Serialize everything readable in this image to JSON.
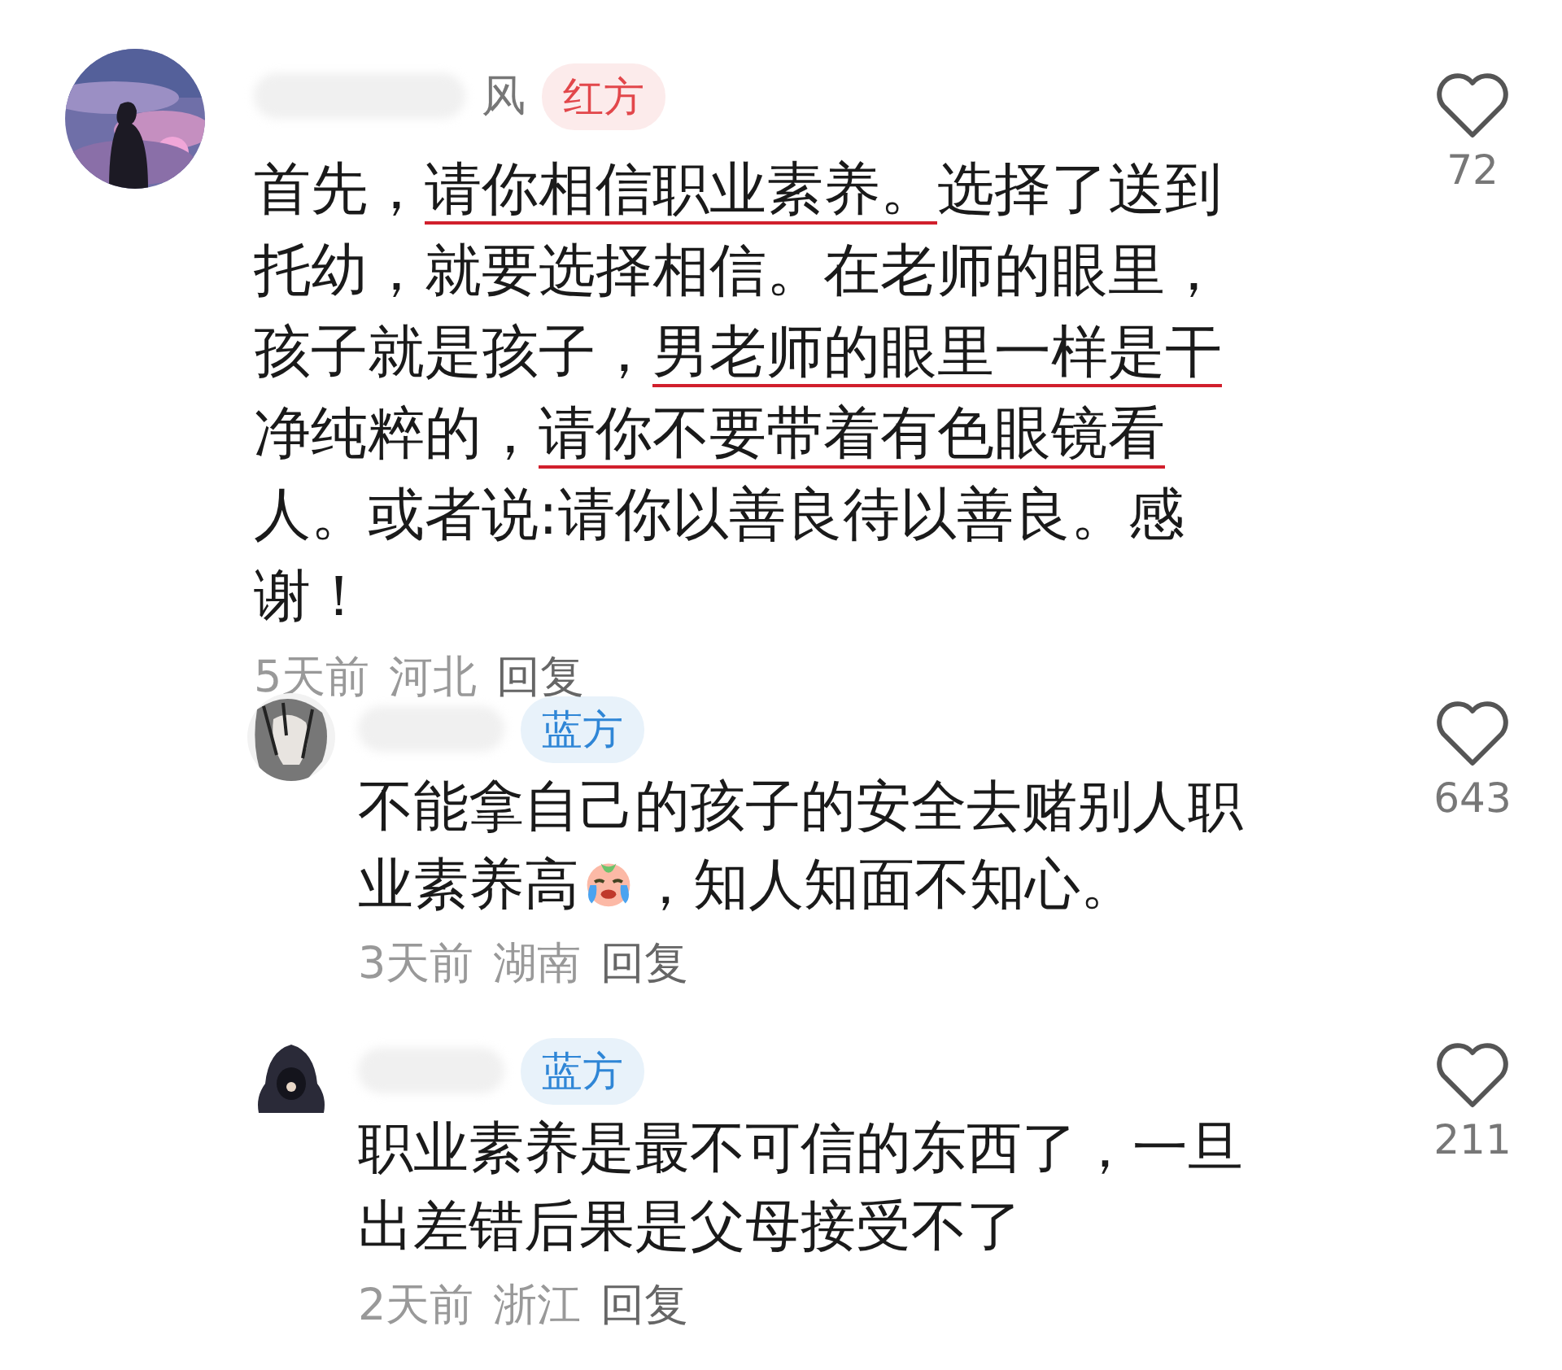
{
  "comments": [
    {
      "name_visible": "风",
      "tag": {
        "text": "红方",
        "color": "#e2474b"
      },
      "body": [
        {
          "text": "首先，",
          "underlined": false
        },
        {
          "text": "请你相信职业素养。",
          "underlined": true
        },
        {
          "text": "选择了送到托幼，就要选择相信。在老师的眼里，孩子就是孩子，",
          "underlined": false
        },
        {
          "text": "男老师的眼里一样是干",
          "underlined": true
        },
        {
          "text": "净纯粹的，",
          "underlined": false
        },
        {
          "text": "请你不要带着有色眼镜看",
          "underlined": true
        },
        {
          "text": "人。或者说:请你以善良待以善良。感谢！",
          "underlined": false
        }
      ],
      "time": "5天前",
      "location": "河北",
      "reply_label": "回复",
      "likes": "72",
      "replies": [
        {
          "tag": {
            "text": "蓝方",
            "color": "#2f86d6"
          },
          "body": [
            {
              "text": "不能拿自己的孩子的安全去赌别人职业素养高",
              "underlined": false
            },
            {
              "kind": "emoji"
            },
            {
              "text": "，知人知面不知心。",
              "underlined": false
            }
          ],
          "time": "3天前",
          "location": "湖南",
          "reply_label": "回复",
          "likes": "643"
        },
        {
          "tag": {
            "text": "蓝方",
            "color": "#2f86d6"
          },
          "body": [
            {
              "text": "职业素养是最不可信的东西了，一旦出差错后果是父母接受不了",
              "underlined": false
            }
          ],
          "time": "2天前",
          "location": "浙江",
          "reply_label": "回复",
          "likes": "211"
        }
      ]
    }
  ]
}
